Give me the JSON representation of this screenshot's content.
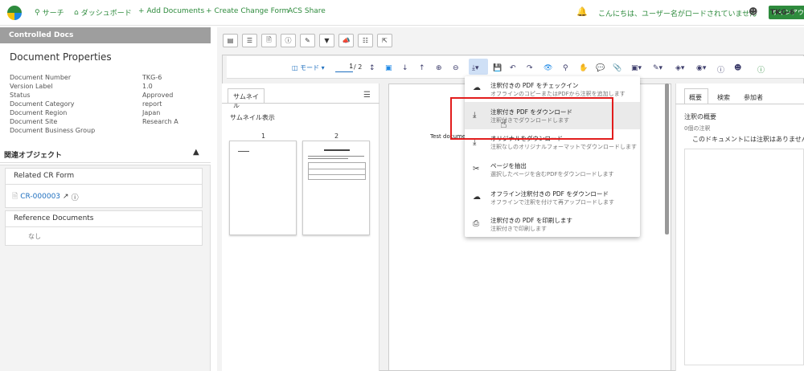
{
  "nav": {
    "search": "サーチ",
    "dashboard": "ダッシュボード",
    "add_documents": "Add Documents",
    "create_change_form": "Create Change Form",
    "acs_share": "ACS Share",
    "greeting": "こんにちは、ユーザー名がロードされていません",
    "signout": "サインアウト"
  },
  "left": {
    "header": "Controlled Docs",
    "props_title": "Document Properties",
    "props": [
      {
        "k": "Document Number",
        "v": "TKG-6"
      },
      {
        "k": "Version Label",
        "v": "1.0"
      },
      {
        "k": "Status",
        "v": "Approved"
      },
      {
        "k": "Document Category",
        "v": "report"
      },
      {
        "k": "Document Region",
        "v": "Japan"
      },
      {
        "k": "Document Site",
        "v": "Research A"
      },
      {
        "k": "Document Business Group",
        "v": ""
      }
    ],
    "related_header": "関連オブジェクト",
    "related_cr_title": "Related CR Form",
    "cr_link": "CR-000003",
    "ref_title": "Reference Documents",
    "ref_none": "なし"
  },
  "doc": {
    "id": "TKG-6",
    "mode_label": "モード",
    "page_current": "1",
    "page_total": "/ 2"
  },
  "thumbs": {
    "tab": "サムネイル",
    "title": "サムネイル表示",
    "page1": "1",
    "page2": "2"
  },
  "main": {
    "test_text": "Test document"
  },
  "right": {
    "tabs": [
      "概要",
      "検索",
      "参加者"
    ],
    "summary_title": "注釈の概要",
    "count": "0個の注釈",
    "none": "このドキュメントには注釈はありません。"
  },
  "dropdown": {
    "items": [
      {
        "title": "注釈付きの PDF をチェックイン",
        "sub": "オフラインのコピーまたはPDFから注釈を追加します",
        "icon": "cloud-upload-icon"
      },
      {
        "title": "注釈付き PDF をダウンロード",
        "sub": "注釈付きでダウンロードします",
        "icon": "download-icon"
      },
      {
        "title": "オリジナルをダウンロード",
        "sub": "注釈なしのオリジナルフォーマットでダウンロードします",
        "icon": "download-original-icon"
      },
      {
        "title": "ページを抽出",
        "sub": "選択したページを含むPDFをダウンロードします",
        "icon": "scissors-icon"
      },
      {
        "title": "オフライン注釈付きの PDF をダウンロード",
        "sub": "オフラインで注釈を付けて再アップロードします",
        "icon": "cloud-download-icon"
      },
      {
        "title": "注釈付きの PDF を印刷します",
        "sub": "注釈付きで印刷します",
        "icon": "printer-icon"
      }
    ]
  },
  "colors": {
    "brand_green": "#2e8b3d",
    "link_blue": "#1e6fbf",
    "highlight_red": "#e21d1d"
  }
}
